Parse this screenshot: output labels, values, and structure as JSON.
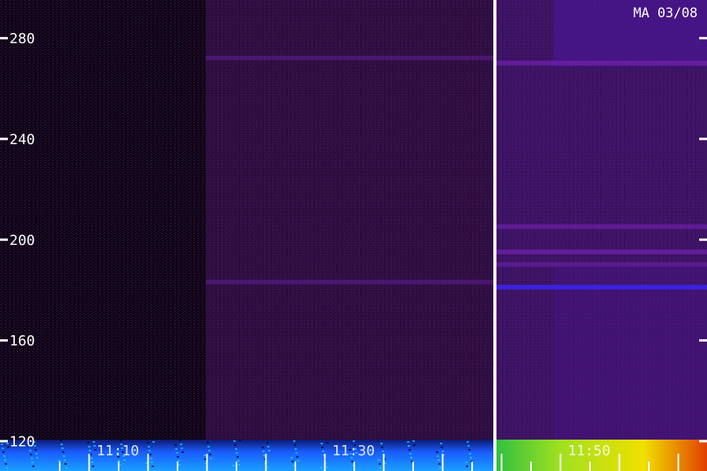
{
  "chart_data": {
    "type": "heatmap",
    "title": "MA 03/08",
    "xlabel": "",
    "ylabel": "",
    "y_ticks": [
      120,
      160,
      200,
      240,
      280
    ],
    "ylim": [
      108,
      295
    ],
    "time_labels": [
      "11:10",
      "11:30",
      "11:50"
    ],
    "scale_gap": "12:00",
    "regions": [
      {
        "name": "early segment",
        "intensity": "low",
        "color": "#0b0410"
      },
      {
        "name": "middle segment",
        "intensity": "low-moderate",
        "color": "#2a0c3a"
      },
      {
        "name": "late segment",
        "intensity": "moderate",
        "color": "#3a1260"
      }
    ],
    "horizontal_bands": [
      {
        "y": 183,
        "segment": "middle",
        "strength": 0.25
      },
      {
        "y": 181,
        "segment": "late",
        "strength": 1.0
      },
      {
        "y": 190,
        "segment": "late",
        "strength": 0.4
      },
      {
        "y": 195,
        "segment": "late",
        "strength": 0.6
      },
      {
        "y": 205,
        "segment": "late",
        "strength": 0.5
      },
      {
        "y": 272,
        "segment": "middle",
        "strength": 0.25
      },
      {
        "y": 270,
        "segment": "late",
        "strength": 0.6
      }
    ],
    "bottom_band_colors": {
      "left": "#2060ff",
      "right": "#f0e000"
    }
  }
}
